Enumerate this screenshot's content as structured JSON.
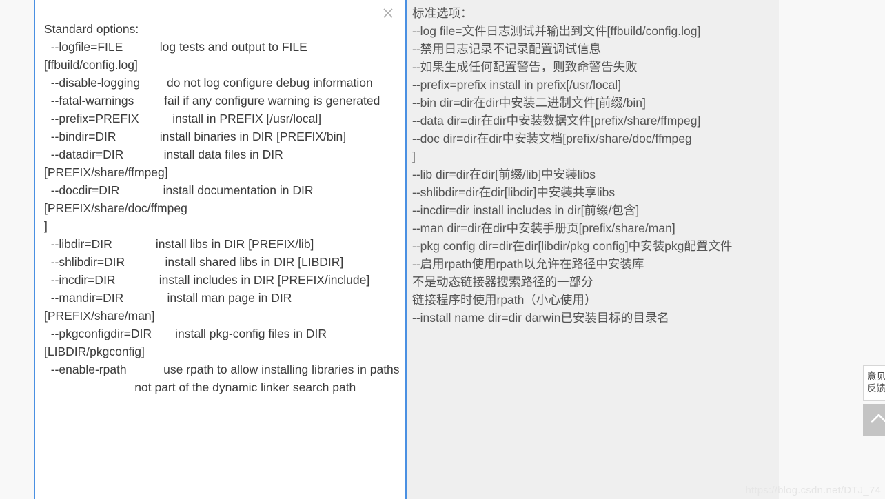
{
  "popup": {
    "close_icon": "close-icon",
    "source": {
      "lang": "en",
      "text": "Standard options:\n  --logfile=FILE           log tests and output to FILE [ffbuild/config.log]\n  --disable-logging        do not log configure debug information\n  --fatal-warnings         fail if any configure warning is generated\n  --prefix=PREFIX          install in PREFIX [/usr/local]\n  --bindir=DIR             install binaries in DIR [PREFIX/bin]\n  --datadir=DIR            install data files in DIR [PREFIX/share/ffmpeg]\n  --docdir=DIR             install documentation in DIR [PREFIX/share/doc/ffmpeg\n]\n  --libdir=DIR             install libs in DIR [PREFIX/lib]\n  --shlibdir=DIR            install shared libs in DIR [LIBDIR]\n  --incdir=DIR             install includes in DIR [PREFIX/include]\n  --mandir=DIR             install man page in DIR [PREFIX/share/man]\n  --pkgconfigdir=DIR       install pkg-config files in DIR [LIBDIR/pkgconfig]\n  --enable-rpath           use rpath to allow installing libraries in paths\n                           not part of the dynamic linker search path"
    },
    "target": {
      "lang": "zh",
      "text": "标准选项：\n--log file=文件日志测试并输出到文件[ffbuild/config.log]\n--禁用日志记录不记录配置调试信息\n--如果生成任何配置警告，则致命警告失败\n--prefix=prefix install in prefix[/usr/local]\n--bin dir=dir在dir中安装二进制文件[前缀/bin]\n--data dir=dir在dir中安装数据文件[prefix/share/ffmpeg]\n--doc dir=dir在dir中安装文档[prefix/share/doc/ffmpeg\n]\n--lib dir=dir在dir[前缀/lib]中安装libs\n--shlibdir=dir在dir[libdir]中安装共享libs\n--incdir=dir install includes in dir[前缀/包含]\n--man dir=dir在dir中安装手册页[prefix/share/man]\n--pkg config dir=dir在dir[libdir/pkg config]中安装pkg配置文件\n--启用rpath使用rpath以允许在路径中安装库\n不是动态链接器搜索路径的一部分\n链接程序时使用rpath（小心使用）\n--install name dir=dir darwin已安装目标的目录名"
    }
  },
  "widgets": {
    "feedback_label": "意见反馈",
    "scroll_top_icon": "chevron-up-icon"
  },
  "watermark": "https://blog.csdn.net/DTJ_74",
  "colors": {
    "accent_border": "#4a90e2",
    "source_bg": "#ffffff",
    "target_bg": "#efefef",
    "page_bg": "#f8f8f8",
    "source_text": "#3c3c3c",
    "target_text": "#555555",
    "scroll_btn_bg": "#c4c4c4",
    "watermark_text": "#e6e6e6"
  }
}
